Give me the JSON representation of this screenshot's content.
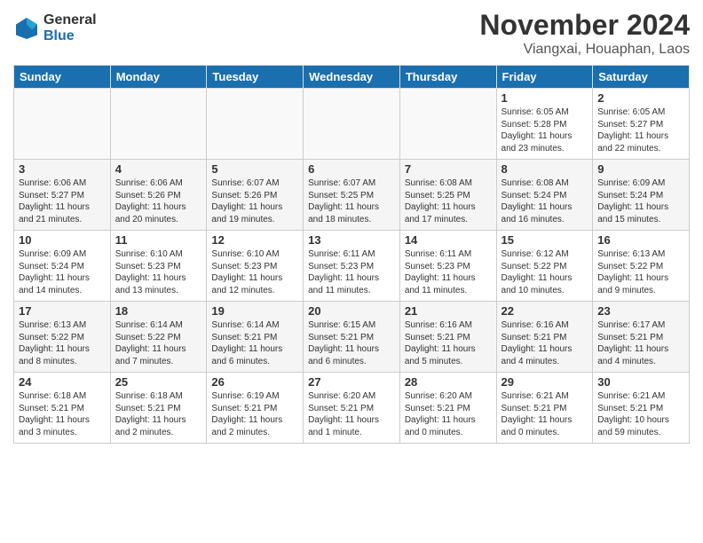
{
  "logo": {
    "general": "General",
    "blue": "Blue"
  },
  "title": "November 2024",
  "location": "Viangxai, Houaphan, Laos",
  "days_of_week": [
    "Sunday",
    "Monday",
    "Tuesday",
    "Wednesday",
    "Thursday",
    "Friday",
    "Saturday"
  ],
  "weeks": [
    [
      {
        "day": "",
        "info": ""
      },
      {
        "day": "",
        "info": ""
      },
      {
        "day": "",
        "info": ""
      },
      {
        "day": "",
        "info": ""
      },
      {
        "day": "",
        "info": ""
      },
      {
        "day": "1",
        "info": "Sunrise: 6:05 AM\nSunset: 5:28 PM\nDaylight: 11 hours\nand 23 minutes."
      },
      {
        "day": "2",
        "info": "Sunrise: 6:05 AM\nSunset: 5:27 PM\nDaylight: 11 hours\nand 22 minutes."
      }
    ],
    [
      {
        "day": "3",
        "info": "Sunrise: 6:06 AM\nSunset: 5:27 PM\nDaylight: 11 hours\nand 21 minutes."
      },
      {
        "day": "4",
        "info": "Sunrise: 6:06 AM\nSunset: 5:26 PM\nDaylight: 11 hours\nand 20 minutes."
      },
      {
        "day": "5",
        "info": "Sunrise: 6:07 AM\nSunset: 5:26 PM\nDaylight: 11 hours\nand 19 minutes."
      },
      {
        "day": "6",
        "info": "Sunrise: 6:07 AM\nSunset: 5:25 PM\nDaylight: 11 hours\nand 18 minutes."
      },
      {
        "day": "7",
        "info": "Sunrise: 6:08 AM\nSunset: 5:25 PM\nDaylight: 11 hours\nand 17 minutes."
      },
      {
        "day": "8",
        "info": "Sunrise: 6:08 AM\nSunset: 5:24 PM\nDaylight: 11 hours\nand 16 minutes."
      },
      {
        "day": "9",
        "info": "Sunrise: 6:09 AM\nSunset: 5:24 PM\nDaylight: 11 hours\nand 15 minutes."
      }
    ],
    [
      {
        "day": "10",
        "info": "Sunrise: 6:09 AM\nSunset: 5:24 PM\nDaylight: 11 hours\nand 14 minutes."
      },
      {
        "day": "11",
        "info": "Sunrise: 6:10 AM\nSunset: 5:23 PM\nDaylight: 11 hours\nand 13 minutes."
      },
      {
        "day": "12",
        "info": "Sunrise: 6:10 AM\nSunset: 5:23 PM\nDaylight: 11 hours\nand 12 minutes."
      },
      {
        "day": "13",
        "info": "Sunrise: 6:11 AM\nSunset: 5:23 PM\nDaylight: 11 hours\nand 11 minutes."
      },
      {
        "day": "14",
        "info": "Sunrise: 6:11 AM\nSunset: 5:23 PM\nDaylight: 11 hours\nand 11 minutes."
      },
      {
        "day": "15",
        "info": "Sunrise: 6:12 AM\nSunset: 5:22 PM\nDaylight: 11 hours\nand 10 minutes."
      },
      {
        "day": "16",
        "info": "Sunrise: 6:13 AM\nSunset: 5:22 PM\nDaylight: 11 hours\nand 9 minutes."
      }
    ],
    [
      {
        "day": "17",
        "info": "Sunrise: 6:13 AM\nSunset: 5:22 PM\nDaylight: 11 hours\nand 8 minutes."
      },
      {
        "day": "18",
        "info": "Sunrise: 6:14 AM\nSunset: 5:22 PM\nDaylight: 11 hours\nand 7 minutes."
      },
      {
        "day": "19",
        "info": "Sunrise: 6:14 AM\nSunset: 5:21 PM\nDaylight: 11 hours\nand 6 minutes."
      },
      {
        "day": "20",
        "info": "Sunrise: 6:15 AM\nSunset: 5:21 PM\nDaylight: 11 hours\nand 6 minutes."
      },
      {
        "day": "21",
        "info": "Sunrise: 6:16 AM\nSunset: 5:21 PM\nDaylight: 11 hours\nand 5 minutes."
      },
      {
        "day": "22",
        "info": "Sunrise: 6:16 AM\nSunset: 5:21 PM\nDaylight: 11 hours\nand 4 minutes."
      },
      {
        "day": "23",
        "info": "Sunrise: 6:17 AM\nSunset: 5:21 PM\nDaylight: 11 hours\nand 4 minutes."
      }
    ],
    [
      {
        "day": "24",
        "info": "Sunrise: 6:18 AM\nSunset: 5:21 PM\nDaylight: 11 hours\nand 3 minutes."
      },
      {
        "day": "25",
        "info": "Sunrise: 6:18 AM\nSunset: 5:21 PM\nDaylight: 11 hours\nand 2 minutes."
      },
      {
        "day": "26",
        "info": "Sunrise: 6:19 AM\nSunset: 5:21 PM\nDaylight: 11 hours\nand 2 minutes."
      },
      {
        "day": "27",
        "info": "Sunrise: 6:20 AM\nSunset: 5:21 PM\nDaylight: 11 hours\nand 1 minute."
      },
      {
        "day": "28",
        "info": "Sunrise: 6:20 AM\nSunset: 5:21 PM\nDaylight: 11 hours\nand 0 minutes."
      },
      {
        "day": "29",
        "info": "Sunrise: 6:21 AM\nSunset: 5:21 PM\nDaylight: 11 hours\nand 0 minutes."
      },
      {
        "day": "30",
        "info": "Sunrise: 6:21 AM\nSunset: 5:21 PM\nDaylight: 10 hours\nand 59 minutes."
      }
    ]
  ]
}
